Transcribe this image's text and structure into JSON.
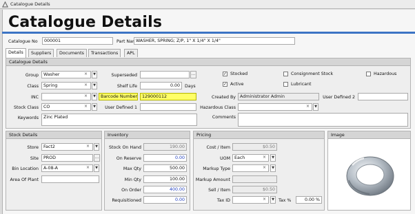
{
  "window": {
    "title": "Catalogue Details"
  },
  "page_title": "Catalogue Details",
  "header": {
    "catalogue_no_label": "Catalogue No",
    "catalogue_no": "000001",
    "part_name_label": "Part Name",
    "part_name": "WASHER, SPRING; Z/P, 1\" X 1/4\" X 1/4\""
  },
  "tabs": [
    "Details",
    "Suppliers",
    "Documents",
    "Transactions",
    "APL"
  ],
  "catalogue_details": {
    "heading": "Catalogue Details",
    "group_label": "Group",
    "group": "Washer",
    "class_label": "Class",
    "class": "Spring",
    "inc_label": "INC",
    "inc": "",
    "stock_class_label": "Stock Class",
    "stock_class": "CO",
    "keywords_label": "Keywords",
    "keywords": "Zinc Plated",
    "superseded_label": "Superseded",
    "superseded": "",
    "shelf_life_label": "Shelf Life",
    "shelf_life": "0.00",
    "shelf_life_unit": "Days",
    "barcode_label": "Barcode Number",
    "barcode": "129000112",
    "user_defined1_label": "User Defined 1",
    "user_defined1": "",
    "stocked_label": "Stocked",
    "stocked": true,
    "active_label": "Active",
    "active": true,
    "consignment_label": "Consignment Stock",
    "consignment": false,
    "lubricant_label": "Lubricant",
    "lubricant": false,
    "hazardous_label": "Hazardous",
    "hazardous": false,
    "created_by_label": "Created By",
    "created_by": "Administrator Admin",
    "user_defined2_label": "User Defined 2",
    "user_defined2": "",
    "hazardous_class_label": "Hazardous Class",
    "hazardous_class": "",
    "comments_label": "Comments",
    "comments": ""
  },
  "stock_details": {
    "heading": "Stock Details",
    "store_label": "Store",
    "store": "Fact2",
    "site_label": "Site",
    "site": "PROD",
    "bin_label": "Bin Location",
    "bin": "A-08-A",
    "area_label": "Area Of Plant",
    "area": ""
  },
  "inventory": {
    "heading": "Inventory",
    "on_hand_label": "Stock On Hand",
    "on_hand": "190.00",
    "on_reserve_label": "On Reserve",
    "on_reserve": "0.00",
    "max_label": "Max Qty",
    "max": "500.00",
    "min_label": "Min Qty",
    "min": "100.00",
    "on_order_label": "On Order",
    "on_order": "400.00",
    "requisitioned_label": "Requisitioned",
    "requisitioned": "0.00"
  },
  "pricing": {
    "heading": "Pricing",
    "cost_label": "Cost / Item",
    "cost": "$0.50",
    "uom_label": "UOM",
    "uom": "Each",
    "markup_type_label": "Markup Type",
    "markup_type": "",
    "markup_amount_label": "Markup Amount",
    "markup_amount": "",
    "sell_label": "Sell / Item",
    "sell": "$0.50",
    "tax_id_label": "Tax ID",
    "tax_id": "",
    "tax_pct_label": "Tax %",
    "tax_pct": "0.00 %"
  },
  "image_panel": {
    "heading": "Image"
  },
  "icons": {
    "clear": "×",
    "dropdown": "▼",
    "ellipsis": "...",
    "check": "✓"
  },
  "colors": {
    "accent_bar": "#3c74c4",
    "barcode_highlight": "#ffff66",
    "value_blue": "#1c3bbf"
  }
}
